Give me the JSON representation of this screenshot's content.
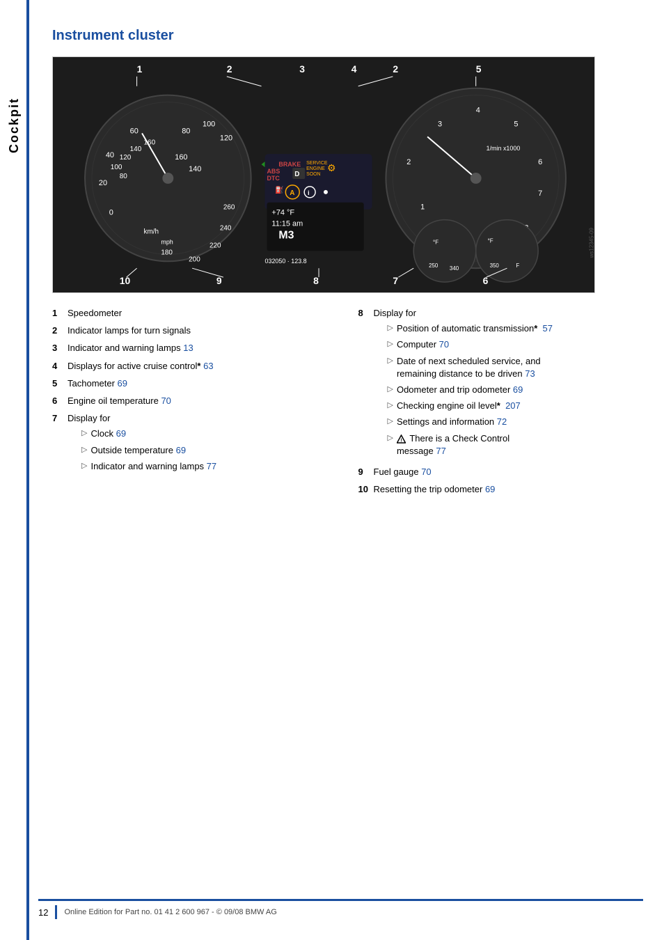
{
  "page": {
    "sidebar_label": "Cockpit",
    "section_title": "Instrument cluster",
    "page_number": "12",
    "footer_text": "Online Edition for Part no. 01 41 2 600 967  -  © 09/08 BMW AG"
  },
  "cluster": {
    "top_numbers": [
      "1",
      "2",
      "3",
      "4",
      "2",
      "5"
    ],
    "bottom_numbers": [
      "10",
      "9",
      "8",
      "7",
      "6"
    ]
  },
  "left_column": {
    "items": [
      {
        "num": "1",
        "text": "Speedometer",
        "ref": null,
        "asterisk": false
      },
      {
        "num": "2",
        "text": "Indicator lamps for turn signals",
        "ref": null,
        "asterisk": false
      },
      {
        "num": "3",
        "text": "Indicator and warning lamps",
        "ref": "13",
        "asterisk": false
      },
      {
        "num": "4",
        "text": "Displays for active cruise control",
        "ref": "63",
        "asterisk": true
      },
      {
        "num": "5",
        "text": "Tachometer",
        "ref": "69",
        "asterisk": false
      },
      {
        "num": "6",
        "text": "Engine oil temperature",
        "ref": "70",
        "asterisk": false
      },
      {
        "num": "7",
        "text": "Display for",
        "ref": null,
        "asterisk": false,
        "subitems": [
          {
            "text": "Clock",
            "ref": "69"
          },
          {
            "text": "Outside temperature",
            "ref": "69"
          },
          {
            "text": "Indicator and warning lamps",
            "ref": "77"
          }
        ]
      }
    ]
  },
  "right_column": {
    "items": [
      {
        "num": "8",
        "text": "Display for",
        "ref": null,
        "asterisk": false,
        "subitems": [
          {
            "text": "Position of automatic transmission",
            "ref": "57",
            "asterisk": true
          },
          {
            "text": "Computer",
            "ref": "70"
          },
          {
            "text": "Date of next scheduled service, and remaining distance to be driven",
            "ref": "73"
          },
          {
            "text": "Odometer and trip odometer",
            "ref": "69"
          },
          {
            "text": "Checking engine oil level",
            "ref": "207",
            "asterisk": true
          },
          {
            "text": "Settings and information",
            "ref": "72"
          },
          {
            "text": "There is a Check Control message",
            "ref": "77",
            "warning": true
          }
        ]
      },
      {
        "num": "9",
        "text": "Fuel gauge",
        "ref": "70",
        "asterisk": false
      },
      {
        "num": "10",
        "text": "Resetting the trip odometer",
        "ref": "69",
        "asterisk": false
      }
    ]
  }
}
